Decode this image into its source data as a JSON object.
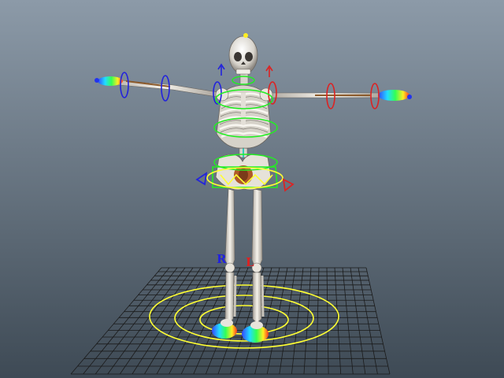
{
  "viewport": {
    "background_top": "#8c9aa8",
    "background_bottom": "#3e4a55",
    "grid_color": "#1a1a1a",
    "rig_control_color": "#ffff33",
    "left_side_color": "#dd2222",
    "right_side_color": "#2222dd",
    "selection_color": "#22ee22"
  },
  "rig": {
    "right_label": "R",
    "left_label": "L",
    "icons": {
      "skeleton": "skeleton-icon",
      "foot_circle": "foot-circle-icon",
      "arm_ring": "arm-ring-icon"
    }
  }
}
